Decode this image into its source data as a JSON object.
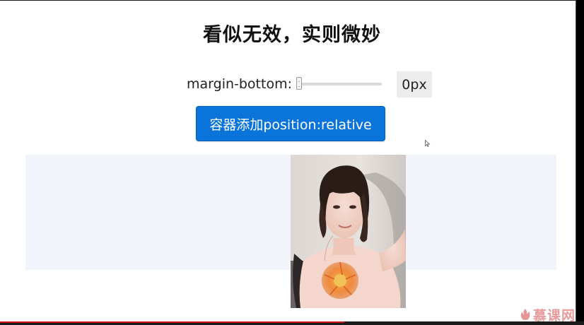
{
  "page": {
    "title": "看似无效，实则微妙"
  },
  "slider": {
    "label": "margin-bottom:",
    "value": 0,
    "min_value": 0,
    "value_display": "0px"
  },
  "action_button": {
    "label": "容器添加position:relative"
  },
  "photo": {
    "subject": "portrait photo of a woman taking a selfie"
  },
  "watermark": {
    "text": "慕课网",
    "icon": "flame-logo-icon"
  },
  "video_progress": {
    "fraction": 0.59
  },
  "colors": {
    "button_bg": "#0a74da",
    "container_bg": "#f1f4fb",
    "value_box_bg": "#ececec",
    "progress": "#cc1111",
    "watermark": "#e07a7a"
  }
}
